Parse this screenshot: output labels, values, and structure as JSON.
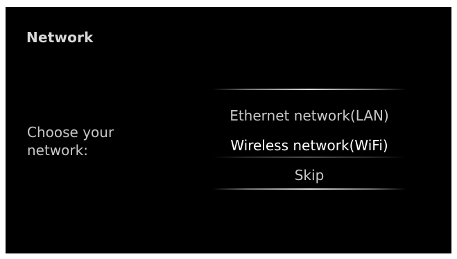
{
  "screen": {
    "title": "Network",
    "prompt": "Choose your network:"
  },
  "menu": {
    "options": [
      {
        "label": "Ethernet network(LAN)",
        "selected": false
      },
      {
        "label": "Wireless network(WiFi)",
        "selected": true
      },
      {
        "label": "Skip",
        "selected": false
      }
    ]
  },
  "colors": {
    "background": "#000000",
    "text": "#c9c9c9",
    "selected_text": "#ffffff"
  }
}
